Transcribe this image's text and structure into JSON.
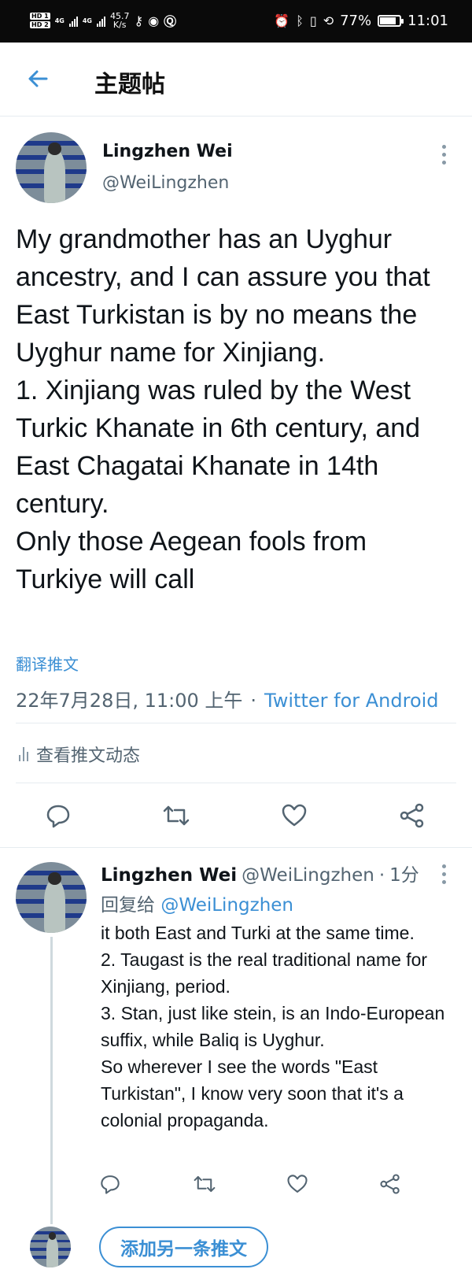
{
  "status_bar": {
    "hd_top": "HD 1",
    "hd_bottom": "HD 2",
    "net1": "4G",
    "net2": "4G",
    "speed_value": "45.7",
    "speed_unit": "K/s",
    "battery": "77%",
    "time": "11:01",
    "icons": [
      "key-icon",
      "eye-icon",
      "q-app-icon",
      "alarm-icon",
      "bluetooth-icon",
      "vibrate-icon",
      "rotation-icon"
    ]
  },
  "header": {
    "back_icon": "arrow-left-icon",
    "title": "主题帖"
  },
  "main_tweet": {
    "author_name": "Lingzhen Wei",
    "author_handle": "@WeiLingzhen",
    "text": "My grandmother has an Uyghur ancestry, and I can assure you that East Turkistan is by no means the Uyghur name for Xinjiang.\n1. Xinjiang was ruled by the West Turkic Khanate in 6th century, and East Chagatai Khanate in 14th century.\nOnly those Aegean fools from Turkiye will call",
    "translate": "翻译推文",
    "timestamp": "22年7月28日, 11:00 上午",
    "separator": "·",
    "source": "Twitter for Android",
    "analytics": "查看推文动态"
  },
  "reply_tweet": {
    "author_name": "Lingzhen Wei",
    "author_handle": "@WeiLingzhen",
    "separator": "·",
    "time": "1分",
    "replying_to_label": "回复给",
    "replying_to_handle": "@WeiLingzhen",
    "text": "it both East and Turki at the same time.\n2. Taugast is the real traditional name for Xinjiang, period.\n3. Stan, just like stein, is an Indo-European suffix, while Baliq is Uyghur.\nSo wherever I see the words \"East Turkistan\", I know very soon that it's a colonial propaganda."
  },
  "compose": {
    "add_button": "添加另一条推文"
  },
  "colors": {
    "accent": "#3b8fd4",
    "text": "#0f1419",
    "muted": "#536471",
    "divider": "#e6ecf0"
  }
}
